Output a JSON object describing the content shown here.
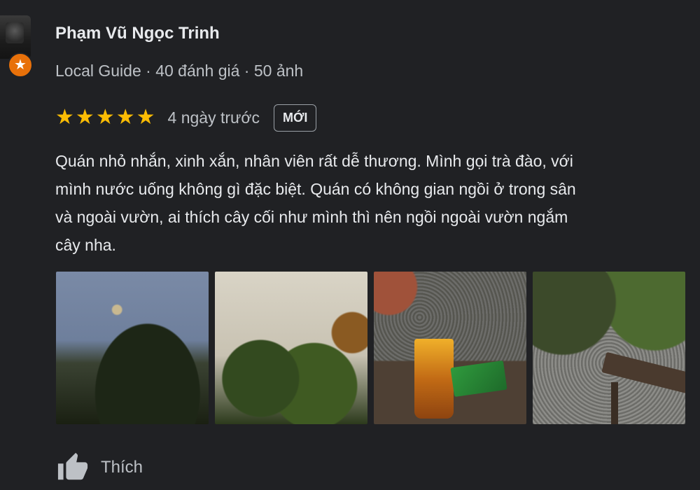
{
  "reviewer": {
    "name": "Phạm Vũ Ngọc Trinh",
    "meta": "Local Guide · 40 đánh giá · 50 ảnh",
    "badge_icon": "local-guide-star-icon",
    "badge_color": "#e8710a"
  },
  "review": {
    "rating": 5,
    "stars": "★★★★★",
    "star_color": "#fbbc04",
    "date": "4 ngày trước",
    "new_badge": "MỚI",
    "text_lines": [
      "Quán nhỏ nhắn, xinh xắn, nhân viên rất dễ thương. Mình gọi trà đào, với",
      "mình nước uống không gì đặc biệt. Quán có không gian ngồi ở trong sân",
      "và ngoài vườn, ai thích cây cối như mình thì nên ngồi ngoài vườn ngắm",
      "cây nha."
    ]
  },
  "actions": {
    "like_label": "Thích",
    "like_icon": "thumbs-up-icon"
  }
}
